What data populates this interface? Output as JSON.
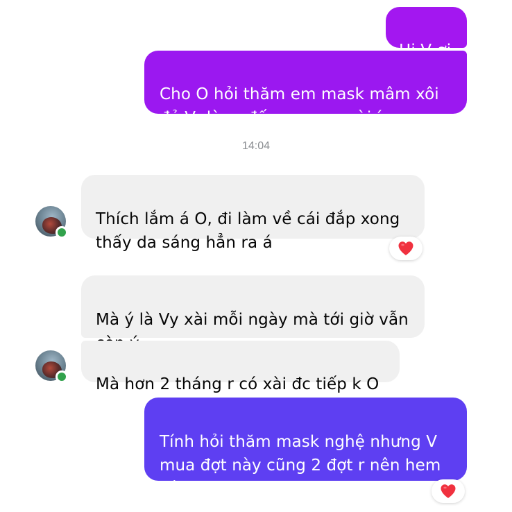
{
  "colors": {
    "outgoing_1": "#a317f0",
    "outgoing_2": "#9b18f0",
    "outgoing_3": "#5e3ff2",
    "incoming": "#f0f0f0",
    "heart": "#f0313f",
    "online": "#31a24c"
  },
  "messages": [
    {
      "sender": "me",
      "text": "Hi V ơi"
    },
    {
      "sender": "me",
      "text": "Cho O hỏi thăm em mask mâm xôi\nđỏ V dùng đến nay sao rùi í"
    },
    {
      "sender": "them",
      "text": "Thích lắm á O, đi làm về cái đắp xong\nthấy da sáng hẳn ra á",
      "reaction": "heart-icon"
    },
    {
      "sender": "them",
      "text": "Mà ý là Vy xài mỗi ngày mà tới giờ vẫn\ncòn ý"
    },
    {
      "sender": "them",
      "text": "Mà hơn 2 tháng r có xài đc tiếp k O"
    },
    {
      "sender": "me",
      "text": "Tính hỏi thăm mask nghệ nhưng V\nmua đợt này cũng 2 đợt r nên hem\ncần hỏi hen 😛",
      "reaction": "heart-icon"
    }
  ],
  "timestamp": "14:04"
}
